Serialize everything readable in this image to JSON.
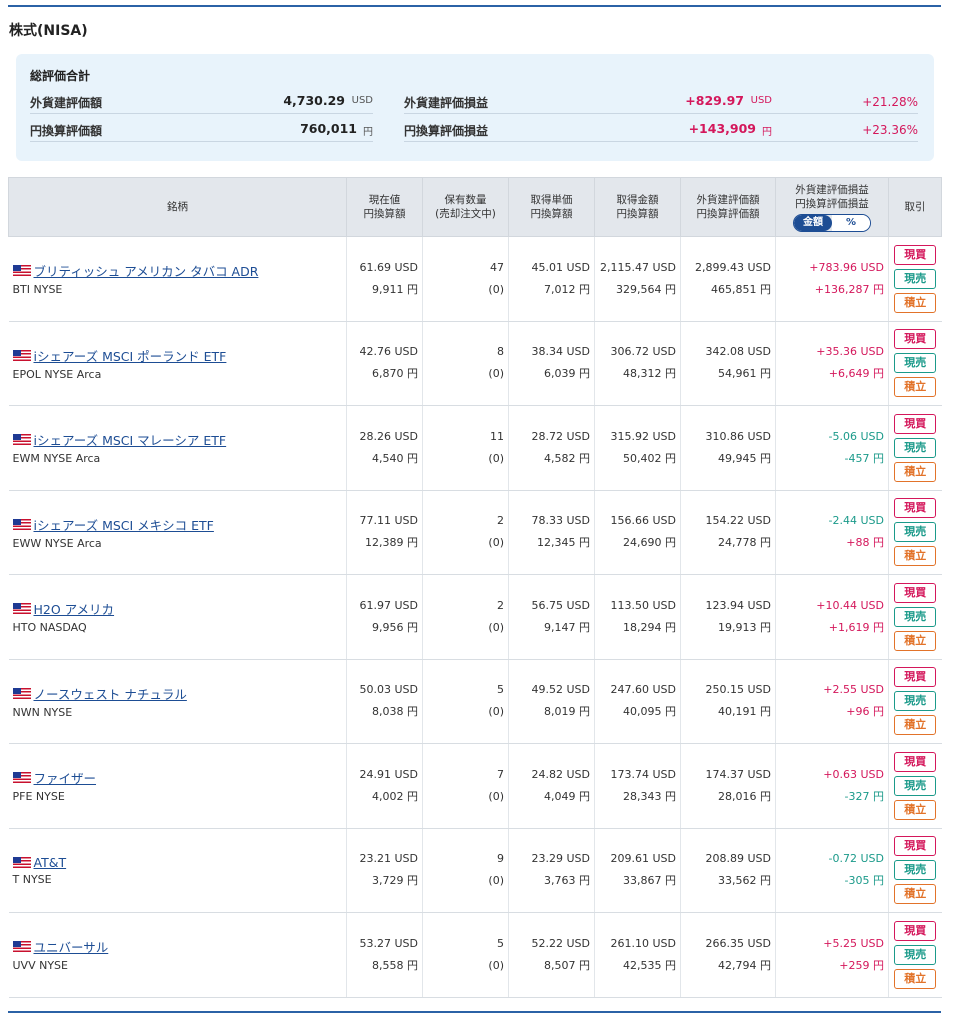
{
  "section_title": "株式(NISA)",
  "summary": {
    "title": "総評価合計",
    "foreign_value_label": "外貨建評価額",
    "foreign_value": "4,730.29",
    "foreign_value_unit": "USD",
    "yen_value_label": "円換算評価額",
    "yen_value": "760,011",
    "yen_value_unit": "円",
    "foreign_pl_label": "外貨建評価損益",
    "foreign_pl": "+829.97",
    "foreign_pl_unit": "USD",
    "foreign_pl_pct": "+21.28%",
    "yen_pl_label": "円換算評価損益",
    "yen_pl": "+143,909",
    "yen_pl_unit": "円",
    "yen_pl_pct": "+23.36%"
  },
  "table": {
    "headers": {
      "name": "銘柄",
      "price_1": "現在値",
      "price_2": "円換算額",
      "qty_1": "保有数量",
      "qty_2": "(売却注文中)",
      "cost_1": "取得単価",
      "cost_2": "円換算額",
      "amount_1": "取得金額",
      "amount_2": "円換算額",
      "value_1": "外貨建評価額",
      "value_2": "円換算評価額",
      "pl_1": "外貨建評価損益",
      "pl_2": "円換算評価損益",
      "toggle_amount": "金額",
      "toggle_pct": "%",
      "trade": "取引"
    },
    "buttons": {
      "buy": "現買",
      "sell": "現売",
      "accumulate": "積立"
    },
    "rows": [
      {
        "name": "ブリティッシュ アメリカン タバコ ADR",
        "code": "BTI NYSE",
        "price_usd": "61.69 USD",
        "price_yen": "9,911 円",
        "qty": "47",
        "qty_pending": "(0)",
        "cost_usd": "45.01 USD",
        "cost_yen": "7,012 円",
        "amount_usd": "2,115.47 USD",
        "amount_yen": "329,564 円",
        "value_usd": "2,899.43 USD",
        "value_yen": "465,851 円",
        "pl_usd": "+783.96 USD",
        "pl_yen": "+136,287 円",
        "pl_usd_sign": "pos",
        "pl_yen_sign": "pos"
      },
      {
        "name": "iシェアーズ MSCI ポーランド ETF",
        "code": "EPOL NYSE Arca",
        "price_usd": "42.76 USD",
        "price_yen": "6,870 円",
        "qty": "8",
        "qty_pending": "(0)",
        "cost_usd": "38.34 USD",
        "cost_yen": "6,039 円",
        "amount_usd": "306.72 USD",
        "amount_yen": "48,312 円",
        "value_usd": "342.08 USD",
        "value_yen": "54,961 円",
        "pl_usd": "+35.36 USD",
        "pl_yen": "+6,649 円",
        "pl_usd_sign": "pos",
        "pl_yen_sign": "pos"
      },
      {
        "name": "iシェアーズ MSCI マレーシア ETF",
        "code": "EWM NYSE Arca",
        "price_usd": "28.26 USD",
        "price_yen": "4,540 円",
        "qty": "11",
        "qty_pending": "(0)",
        "cost_usd": "28.72 USD",
        "cost_yen": "4,582 円",
        "amount_usd": "315.92 USD",
        "amount_yen": "50,402 円",
        "value_usd": "310.86 USD",
        "value_yen": "49,945 円",
        "pl_usd": "-5.06 USD",
        "pl_yen": "-457 円",
        "pl_usd_sign": "neg",
        "pl_yen_sign": "neg"
      },
      {
        "name": "iシェアーズ MSCI メキシコ ETF",
        "code": "EWW NYSE Arca",
        "price_usd": "77.11 USD",
        "price_yen": "12,389 円",
        "qty": "2",
        "qty_pending": "(0)",
        "cost_usd": "78.33 USD",
        "cost_yen": "12,345 円",
        "amount_usd": "156.66 USD",
        "amount_yen": "24,690 円",
        "value_usd": "154.22 USD",
        "value_yen": "24,778 円",
        "pl_usd": "-2.44 USD",
        "pl_yen": "+88 円",
        "pl_usd_sign": "neg",
        "pl_yen_sign": "pos"
      },
      {
        "name": "H2O アメリカ",
        "code": "HTO NASDAQ",
        "price_usd": "61.97 USD",
        "price_yen": "9,956 円",
        "qty": "2",
        "qty_pending": "(0)",
        "cost_usd": "56.75 USD",
        "cost_yen": "9,147 円",
        "amount_usd": "113.50 USD",
        "amount_yen": "18,294 円",
        "value_usd": "123.94 USD",
        "value_yen": "19,913 円",
        "pl_usd": "+10.44 USD",
        "pl_yen": "+1,619 円",
        "pl_usd_sign": "pos",
        "pl_yen_sign": "pos"
      },
      {
        "name": "ノースウェスト ナチュラル",
        "code": "NWN NYSE",
        "price_usd": "50.03 USD",
        "price_yen": "8,038 円",
        "qty": "5",
        "qty_pending": "(0)",
        "cost_usd": "49.52 USD",
        "cost_yen": "8,019 円",
        "amount_usd": "247.60 USD",
        "amount_yen": "40,095 円",
        "value_usd": "250.15 USD",
        "value_yen": "40,191 円",
        "pl_usd": "+2.55 USD",
        "pl_yen": "+96 円",
        "pl_usd_sign": "pos",
        "pl_yen_sign": "pos"
      },
      {
        "name": "ファイザー",
        "code": "PFE NYSE",
        "price_usd": "24.91 USD",
        "price_yen": "4,002 円",
        "qty": "7",
        "qty_pending": "(0)",
        "cost_usd": "24.82 USD",
        "cost_yen": "4,049 円",
        "amount_usd": "173.74 USD",
        "amount_yen": "28,343 円",
        "value_usd": "174.37 USD",
        "value_yen": "28,016 円",
        "pl_usd": "+0.63 USD",
        "pl_yen": "-327 円",
        "pl_usd_sign": "pos",
        "pl_yen_sign": "neg"
      },
      {
        "name": "AT&T",
        "code": "T NYSE",
        "price_usd": "23.21 USD",
        "price_yen": "3,729 円",
        "qty": "9",
        "qty_pending": "(0)",
        "cost_usd": "23.29 USD",
        "cost_yen": "3,763 円",
        "amount_usd": "209.61 USD",
        "amount_yen": "33,867 円",
        "value_usd": "208.89 USD",
        "value_yen": "33,562 円",
        "pl_usd": "-0.72 USD",
        "pl_yen": "-305 円",
        "pl_usd_sign": "neg",
        "pl_yen_sign": "neg"
      },
      {
        "name": "ユニバーサル",
        "code": "UVV NYSE",
        "price_usd": "53.27 USD",
        "price_yen": "8,558 円",
        "qty": "5",
        "qty_pending": "(0)",
        "cost_usd": "52.22 USD",
        "cost_yen": "8,507 円",
        "amount_usd": "261.10 USD",
        "amount_yen": "42,535 円",
        "value_usd": "266.35 USD",
        "value_yen": "42,794 円",
        "pl_usd": "+5.25 USD",
        "pl_yen": "+259 円",
        "pl_usd_sign": "pos",
        "pl_yen_sign": "pos"
      }
    ]
  },
  "colors": {
    "positive": "#d4175b",
    "negative": "#1b9a8a",
    "accent": "#1d4d94",
    "accumulate": "#e2732a"
  },
  "icons": {
    "flag": "us-flag-icon"
  }
}
